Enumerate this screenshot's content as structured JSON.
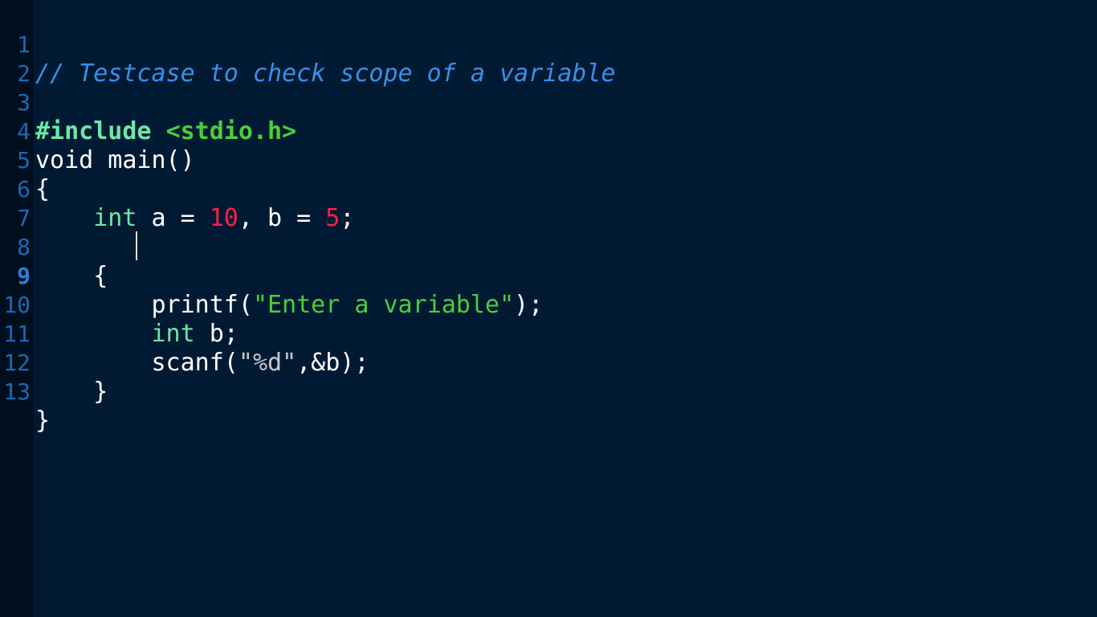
{
  "editor": {
    "colors": {
      "background": "#011a33",
      "gutter": "#000f1e",
      "line_number": "#1d68b8",
      "comment": "#3a8fe8",
      "type_keyword": "#6ee7a8",
      "string": "#4ccd3c",
      "number": "#ff1f4b",
      "text": "#ffffff"
    },
    "current_line": "9",
    "lines": [
      {
        "n": "1",
        "tokens": {
          "comment": "// Testcase to check scope of a variable"
        }
      },
      {
        "n": "2",
        "tokens": {}
      },
      {
        "n": "3",
        "tokens": {
          "preproc": "#include",
          "sp": " ",
          "header": "<stdio.h>"
        }
      },
      {
        "n": "4",
        "tokens": {
          "t1": "void",
          "t2": " main()"
        }
      },
      {
        "n": "5",
        "tokens": {
          "t1": "{"
        }
      },
      {
        "n": "6",
        "tokens": {
          "indent": "    ",
          "type": "int",
          "t1": " a = ",
          "num1": "10",
          "t2": ", b = ",
          "num2": "5",
          "t3": ";"
        }
      },
      {
        "n": "7",
        "tokens": {}
      },
      {
        "n": "8",
        "tokens": {
          "indent": "    ",
          "t1": "{"
        }
      },
      {
        "n": "9",
        "tokens": {
          "indent": "        ",
          "t1": "printf(",
          "str": "\"Enter a variable\"",
          "t2": ");"
        }
      },
      {
        "n": "10",
        "tokens": {
          "indent": "        ",
          "type": "int",
          "t1": " b;"
        }
      },
      {
        "n": "11",
        "tokens": {
          "indent": "        ",
          "t1": "scanf(",
          "q1": "\"",
          "fmt": "%d",
          "q2": "\"",
          "t2": ",&b);"
        }
      },
      {
        "n": "12",
        "tokens": {
          "indent": "    ",
          "t1": "}"
        }
      },
      {
        "n": "13",
        "tokens": {
          "t1": "}"
        }
      }
    ]
  }
}
